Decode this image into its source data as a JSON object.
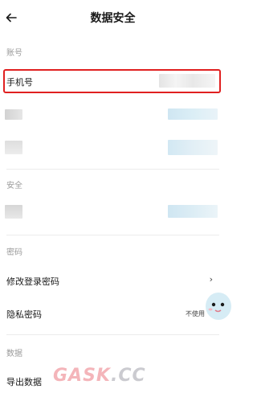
{
  "header": {
    "title": "数据安全",
    "back_icon": "arrow-left-icon"
  },
  "sections": {
    "account": {
      "title": "账号",
      "phone_label": "手机号"
    },
    "security": {
      "title": "安全"
    },
    "password": {
      "title": "密码",
      "change_login_password": "修改登录密码",
      "privacy_password": "隐私密码",
      "privacy_password_status": "不使用",
      "chevron": "›"
    },
    "data": {
      "title": "数据",
      "export_data": "导出数据"
    }
  },
  "watermark": {
    "part1": "GASK",
    "part2": ".CC"
  },
  "colors": {
    "highlight": "#e02020",
    "blur_blue": "#cfe6f2",
    "blur_gray": "#d9d9d9"
  }
}
